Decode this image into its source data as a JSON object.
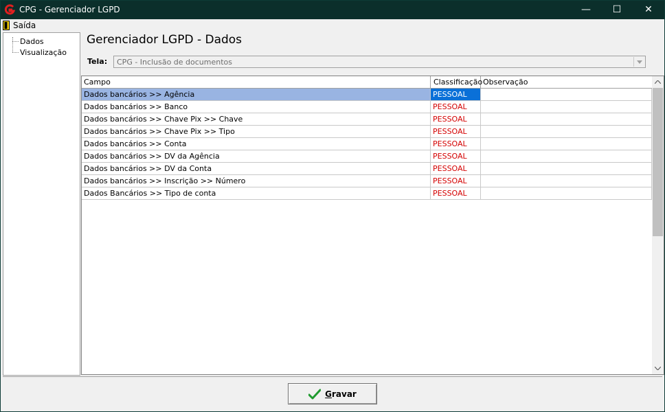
{
  "window": {
    "title": "CPG - Gerenciador LGPD",
    "minimize": "—",
    "maximize": "☐",
    "close": "✕"
  },
  "menu": {
    "exit_label": "Saída"
  },
  "tree": {
    "items": [
      {
        "label": "Dados"
      },
      {
        "label": "Visualização"
      }
    ]
  },
  "main": {
    "heading": "Gerenciador LGPD - Dados",
    "tela_label": "Tela:",
    "tela_value": "CPG - Inclusão de documentos"
  },
  "grid": {
    "columns": [
      "Campo",
      "Classificação",
      "Observação"
    ],
    "rows": [
      {
        "campo": "Dados bancários >> Agência",
        "classificacao": "PESSOAL",
        "observacao": ""
      },
      {
        "campo": "Dados bancários >> Banco",
        "classificacao": "PESSOAL",
        "observacao": ""
      },
      {
        "campo": "Dados bancários >> Chave Pix >> Chave",
        "classificacao": "PESSOAL",
        "observacao": ""
      },
      {
        "campo": "Dados bancários >> Chave Pix >> Tipo",
        "classificacao": "PESSOAL",
        "observacao": ""
      },
      {
        "campo": "Dados bancários >> Conta",
        "classificacao": "PESSOAL",
        "observacao": ""
      },
      {
        "campo": "Dados bancários >> DV da Agência",
        "classificacao": "PESSOAL",
        "observacao": ""
      },
      {
        "campo": "Dados bancários >> DV da Conta",
        "classificacao": "PESSOAL",
        "observacao": ""
      },
      {
        "campo": "Dados bancários >> Inscrição >> Número",
        "classificacao": "PESSOAL",
        "observacao": ""
      },
      {
        "campo": "Dados Bancários >> Tipo de conta",
        "classificacao": "PESSOAL",
        "observacao": ""
      }
    ],
    "selected_row": 0
  },
  "footer": {
    "save_accel": "G",
    "save_rest": "ravar"
  },
  "colors": {
    "titlebar": "#0b2f2b",
    "selected_row": "#99b4e2",
    "selected_cell": "#0a70d8",
    "classification_text": "#d40000"
  }
}
